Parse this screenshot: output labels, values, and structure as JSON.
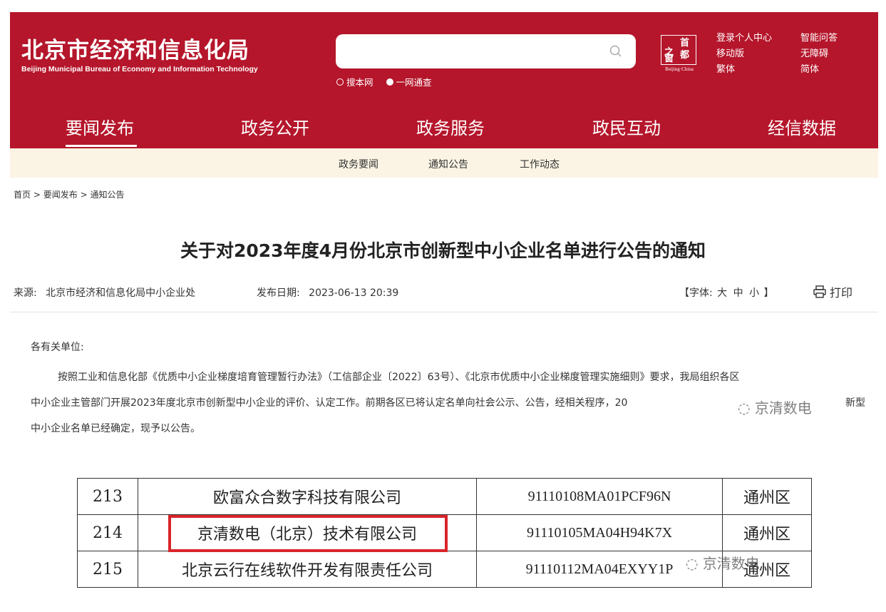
{
  "header": {
    "logo_cn": "北京市经济和信息化局",
    "logo_en": "Beijing Municipal Bureau of Economy and Information Technology",
    "search_placeholder": "",
    "search_options": [
      "搜本网",
      "一网通查"
    ],
    "seal_chars": [
      "之",
      "首",
      "窗",
      "都"
    ],
    "seal_sub": "Beijing·China",
    "links_col1": [
      "登录个人中心",
      "移动版",
      "繁体"
    ],
    "links_col2": [
      "智能问答",
      "无障碍",
      "简体"
    ]
  },
  "nav": {
    "items": [
      "要闻发布",
      "政务公开",
      "政务服务",
      "政民互动",
      "经信数据"
    ],
    "active": 0
  },
  "subnav": {
    "items": [
      "政务要闻",
      "通知公告",
      "工作动态"
    ]
  },
  "breadcrumb": [
    "首页",
    ">",
    "要闻发布",
    ">",
    "通知公告"
  ],
  "article": {
    "title": "关于对2023年度4月份北京市创新型中小企业名单进行公告的通知",
    "source_label": "来源:",
    "source": "北京市经济和信息化局中小企业处",
    "date_label": "发布日期:",
    "date": "2023-06-13 20:39",
    "font_label_open": "【字体:",
    "font_sizes": [
      "大",
      "中",
      "小"
    ],
    "font_label_close": "】",
    "print_label": "打印",
    "salutation": "各有关单位:",
    "para_line1": "按照工业和信息化部《优质中小企业梯度培育管理暂行办法》（工信部企业〔2022〕63号）、《北京市优质中小企业梯度管理实施细则》要求，我局组织各区",
    "para_line2": "中小企业主管部门开展2023年度北京市创新型中小企业的评价、认定工作。前期各区已将认定名单向社会公示、公告，经相关程序，20",
    "para_line2_tail": "新型",
    "para_line3": "中小企业名单已经确定，现予以公告。"
  },
  "watermark": "京清数电",
  "table": {
    "rows": [
      {
        "no": "213",
        "name": "欧富众合数字科技有限公司",
        "code": "91110108MA01PCF96N",
        "district": "通州区"
      },
      {
        "no": "214",
        "name": "京清数电（北京）技术有限公司",
        "code": "91110105MA04H94K7X",
        "district": "通州区"
      },
      {
        "no": "215",
        "name": "北京云行在线软件开发有限责任公司",
        "code": "91110112MA04EXYY1P",
        "district": "通州区"
      }
    ]
  },
  "colors": {
    "brand_red": "#b5162b",
    "subnav_bg": "#fbf4e4",
    "highlight": "#d9252a"
  }
}
